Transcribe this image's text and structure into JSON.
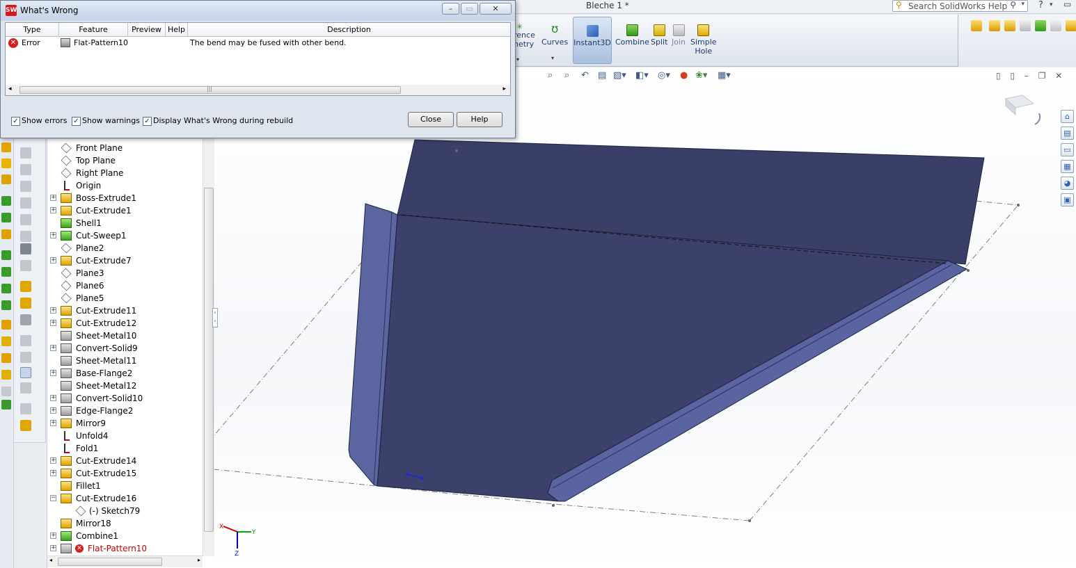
{
  "document_title": "Bleche 1 *",
  "search": {
    "placeholder": "Search SolidWorks Help"
  },
  "ribbon": {
    "items": [
      {
        "label": "rence\nnetry"
      },
      {
        "label": "Curves"
      },
      {
        "label": "Instant3D"
      },
      {
        "label": "Combine"
      },
      {
        "label": "Split"
      },
      {
        "label": "Join"
      },
      {
        "label": "Simple\nHole"
      }
    ]
  },
  "dialog": {
    "title": "What's Wrong",
    "columns": [
      "Type",
      "Feature",
      "Preview",
      "Help",
      "Description"
    ],
    "rows": [
      {
        "type": "Error",
        "feature": "Flat-Pattern10",
        "description": "The bend may be fused with other bend."
      }
    ],
    "checkboxes": [
      {
        "label": "Show errors",
        "checked": true
      },
      {
        "label": "Show warnings",
        "checked": true
      },
      {
        "label": "Display What's Wrong during rebuild",
        "checked": true
      }
    ],
    "close_label": "Close",
    "help_label": "Help"
  },
  "tree": {
    "items": [
      {
        "label": "Front Plane",
        "icon": "plane-icon"
      },
      {
        "label": "Top Plane",
        "icon": "plane-icon"
      },
      {
        "label": "Right Plane",
        "icon": "plane-icon"
      },
      {
        "label": "Origin",
        "icon": "origin-icon"
      },
      {
        "label": "Boss-Extrude1",
        "icon": "extrude-icon",
        "expandable": true
      },
      {
        "label": "Cut-Extrude1",
        "icon": "cut-extrude-icon",
        "expandable": true
      },
      {
        "label": "Shell1",
        "icon": "shell-icon"
      },
      {
        "label": "Cut-Sweep1",
        "icon": "cut-sweep-icon",
        "expandable": true
      },
      {
        "label": "Plane2",
        "icon": "plane-icon"
      },
      {
        "label": "Cut-Extrude7",
        "icon": "cut-extrude-icon",
        "expandable": true
      },
      {
        "label": "Plane3",
        "icon": "plane-icon"
      },
      {
        "label": "Plane6",
        "icon": "plane-icon"
      },
      {
        "label": "Plane5",
        "icon": "plane-icon"
      },
      {
        "label": "Cut-Extrude11",
        "icon": "cut-extrude-icon",
        "expandable": true
      },
      {
        "label": "Cut-Extrude12",
        "icon": "cut-extrude-icon",
        "expandable": true
      },
      {
        "label": "Sheet-Metal10",
        "icon": "sheet-metal-icon"
      },
      {
        "label": "Convert-Solid9",
        "icon": "convert-solid-icon",
        "expandable": true
      },
      {
        "label": "Sheet-Metal11",
        "icon": "sheet-metal-icon"
      },
      {
        "label": "Base-Flange2",
        "icon": "base-flange-icon",
        "expandable": true
      },
      {
        "label": "Sheet-Metal12",
        "icon": "sheet-metal-icon"
      },
      {
        "label": "Convert-Solid10",
        "icon": "convert-solid-icon",
        "expandable": true
      },
      {
        "label": "Edge-Flange2",
        "icon": "edge-flange-icon",
        "expandable": true
      },
      {
        "label": "Mirror9",
        "icon": "mirror-icon",
        "expandable": true
      },
      {
        "label": "Unfold4",
        "icon": "unfold-icon"
      },
      {
        "label": "Fold1",
        "icon": "fold-icon"
      },
      {
        "label": "Cut-Extrude14",
        "icon": "cut-extrude-icon",
        "expandable": true
      },
      {
        "label": "Cut-Extrude15",
        "icon": "cut-extrude-icon",
        "expandable": true
      },
      {
        "label": "Fillet1",
        "icon": "fillet-icon"
      },
      {
        "label": "Cut-Extrude16",
        "icon": "cut-extrude-icon",
        "expandable": true,
        "expanded": true
      },
      {
        "label": "(-) Sketch79",
        "icon": "sketch-icon",
        "child": true
      },
      {
        "label": "Mirror18",
        "icon": "mirror-icon"
      },
      {
        "label": "Combine1",
        "icon": "combine-icon",
        "expandable": true
      },
      {
        "label": "Flat-Pattern10",
        "icon": "flat-pattern-icon",
        "expandable": true,
        "error": true
      }
    ]
  },
  "triad": {
    "x": "X",
    "y": "Y",
    "z": "Z"
  },
  "colors": {
    "part_face": "#393f66",
    "part_flange": "#5b65a0",
    "error_red": "#c80000",
    "accent": "#1d3a6b"
  }
}
